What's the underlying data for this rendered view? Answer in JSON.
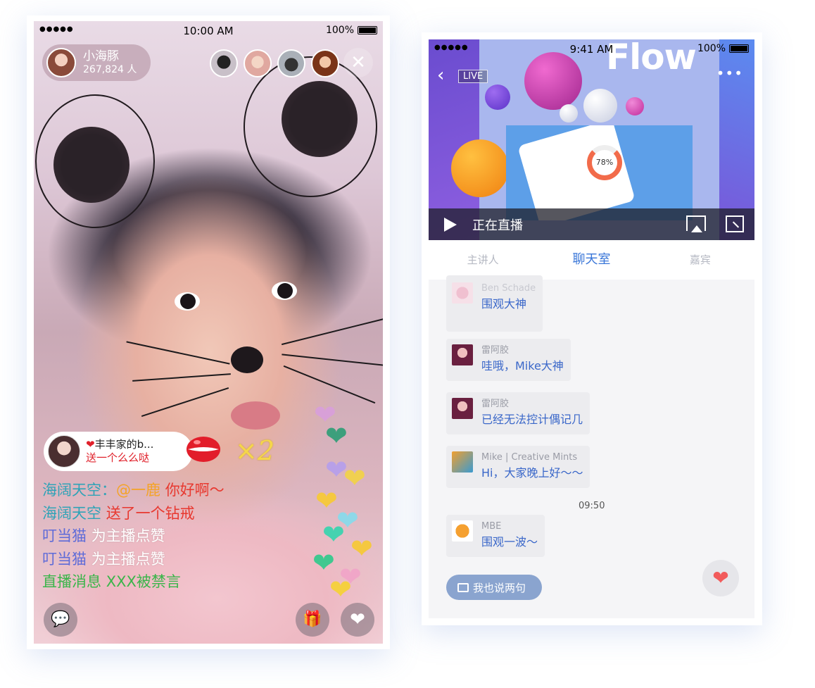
{
  "left_phone": {
    "status": {
      "signal": "●●●●●",
      "time": "10:00 AM",
      "battery": "100%"
    },
    "host": {
      "name": "小海豚",
      "viewers": "267,824 人"
    },
    "close_glyph": "✕",
    "gift": {
      "heart": "❤",
      "user": "丰丰家的b...",
      "desc": "送一个么么哒",
      "combo": "×2"
    },
    "chat": [
      {
        "user": "海阔天空：",
        "mention": "@一鹿",
        "msg": "你好啊～"
      },
      {
        "user": "海阔天空",
        "msg": "送了一个钻戒"
      },
      {
        "user": "叮当猫",
        "msg": "为主播点赞"
      },
      {
        "user": "叮当猫",
        "msg": "为主播点赞"
      },
      {
        "user": "直播消息",
        "msg": "XXX被禁言"
      }
    ],
    "bottom": {
      "chat_glyph": "💬",
      "gift_glyph": "🎁",
      "heart_glyph": "❤"
    }
  },
  "right_phone": {
    "status": {
      "signal": "●●●●●",
      "time": "9:41 AM",
      "battery": "100%"
    },
    "video": {
      "brand": "Flow",
      "badge": "LIVE",
      "live_text": "正在直播",
      "back_glyph": "‹",
      "more_glyph": "•••",
      "ring_value": "78%"
    },
    "tabs": [
      "主讲人",
      "聊天室",
      "嘉宾"
    ],
    "messages": [
      {
        "name": "Ben Schade",
        "msg": "围观大神"
      },
      {
        "name": "雷阿胶",
        "msg": "哇哦，Mike大神"
      },
      {
        "name": "雷阿胶",
        "msg": "已经无法控计偶记几"
      },
      {
        "name": "Mike | Creative Mints",
        "msg": "Hi，大家晚上好～～"
      },
      {
        "name": "MBE",
        "msg": "围观一波～"
      }
    ],
    "timestamp": "09:50",
    "say_button": "我也说两句",
    "like_glyph": "❤"
  },
  "colors": {
    "accent_blue": "#3976d8",
    "chat_blue": "#3a67c9",
    "like_red": "#f25b5b",
    "chat_red": "#e8382f",
    "chat_green": "#3ab54a"
  }
}
